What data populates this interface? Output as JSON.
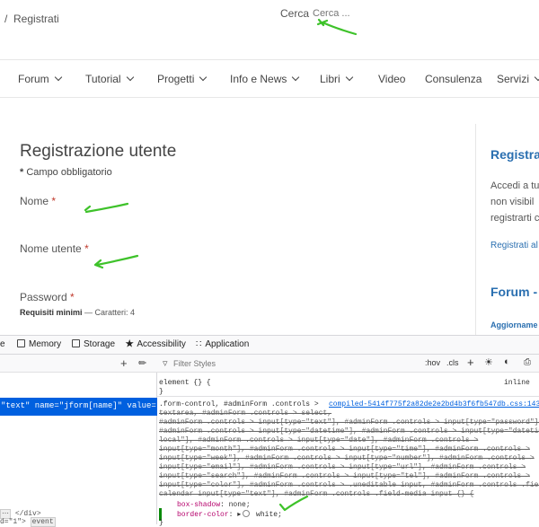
{
  "topbar": {
    "breadcrumb_sep": "/",
    "breadcrumb": "Registrati",
    "search_label": "Cerca",
    "search_placeholder": "Cerca ..."
  },
  "nav": {
    "items": [
      "Forum",
      "Tutorial",
      "Progetti",
      "Info e News",
      "Libri",
      "Video",
      "Consulenza",
      "Servizi"
    ]
  },
  "form": {
    "title": "Registrazione utente",
    "required_note": "Campo obbligatorio",
    "required_mark": "*",
    "fields": [
      {
        "label": "Nome"
      },
      {
        "label": "Nome utente"
      },
      {
        "label": "Password"
      }
    ],
    "password_req_strong": "Requisiti minimi",
    "password_req_rest": " — Caratteri: 4"
  },
  "sidebar": {
    "title": "Registra",
    "text": [
      "Accedi a tu",
      "non visibil",
      "registrarti c"
    ],
    "link": "Registrati al",
    "forum_title": "Forum -",
    "strong": "Aggiorname"
  },
  "devtools": {
    "tabs": [
      "Memory",
      "Storage",
      "Accessibility",
      "Application"
    ],
    "selected_node": "\"text\" name=\"jform[name]\" value=\"\"",
    "node_close": "</div>",
    "node_bottom": "d=\"1\">",
    "node_badge": "event",
    "filter_placeholder": "Filter Styles",
    "hov": ":hov",
    "cls": ".cls",
    "element_rule": "element {} {",
    "inline": "inline",
    "close_brace": "}",
    "selector_lines": [
      ".form-control, #adminForm .controls >",
      "textarea, #adminForm .controls > select,",
      "#adminForm .controls > input[type=\"text\"], #adminForm .controls > input[type=\"password\"],",
      "#adminForm .controls > input[type=\"datetime\"], #adminForm .controls > input[type=\"datetime",
      "local\"], #adminForm .controls > input[type=\"date\"], #adminForm .controls >",
      "input[type=\"month\"], #adminForm .controls > input[type=\"time\"], #adminForm .controls >",
      "input[type=\"week\"], #adminForm .controls > input[type=\"number\"], #adminForm .controls >",
      "input[type=\"email\"], #adminForm .controls > input[type=\"url\"], #adminForm .controls >",
      "input[type=\"search\"], #adminForm .controls > input[type=\"tel\"], #adminForm .controls >",
      "input[type=\"color\"], #adminForm .controls > .uneditable input, #adminForm .controls .field",
      "calendar input[type=\"text\"], #adminForm .controls .field-media input {} {"
    ],
    "source": "compiled-5414f775f2a82de2e2bd4b3f6fb547db.css:14352",
    "prop1_name": "box-shadow",
    "prop1_value": "none",
    "prop2_name": "border-color",
    "prop2_value": "white"
  },
  "colors": {
    "link": "#2a6fb0",
    "annotation": "#3ec22a",
    "selection": "#0060df"
  }
}
